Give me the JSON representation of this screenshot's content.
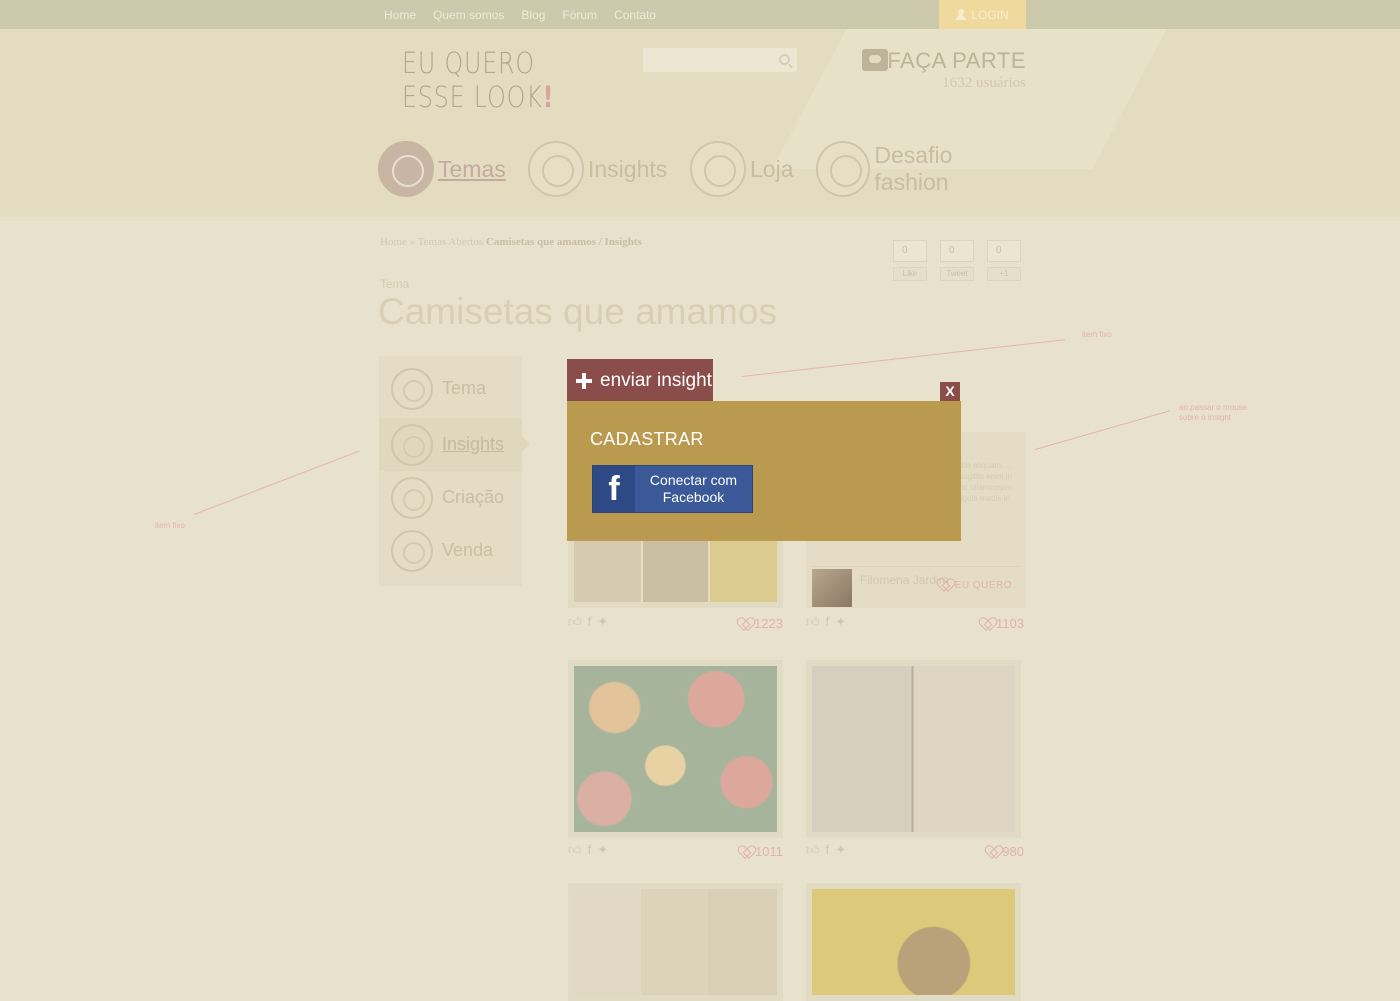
{
  "topnav": {
    "items": [
      "Home",
      "Quem somos",
      "Blog",
      "Fórum",
      "Contato"
    ],
    "login_label": "LOGIN"
  },
  "header": {
    "logo_line1": "EU QUERO",
    "logo_line2": "ESSE LOOK",
    "logo_mark": "!",
    "search_placeholder": "",
    "faca_parte": "FAÇA PARTE",
    "users_count": "1632 usuários"
  },
  "mainnav": [
    {
      "label": "Temas",
      "icon": "tshirt-icon"
    },
    {
      "label": "Insights",
      "icon": "lightbulb-icon"
    },
    {
      "label": "Loja",
      "icon": "shop-tag-icon"
    },
    {
      "label": "Desafio fashion",
      "icon": "puzzle-icon"
    }
  ],
  "breadcrumb": {
    "home": "Home",
    "sep": "»",
    "temas": "Temas Abertos",
    "current": "Camisetas que amamos / Insights"
  },
  "social": [
    {
      "count": "0",
      "label": "Like"
    },
    {
      "count": "0",
      "label": "Tweet"
    },
    {
      "count": "0",
      "label": "+1"
    }
  ],
  "page": {
    "label": "Tema",
    "title": "Camisetas que amamos"
  },
  "annotations": {
    "item_fixo_right": "item fixo",
    "item_fixo_left": "item fixo",
    "hover_line1": "ao passar o mouse",
    "hover_line2": "sobre o insight"
  },
  "sidebar": [
    {
      "label": "Tema",
      "icon": "tshirt-icon"
    },
    {
      "label": "Insights",
      "icon": "lightbulb-icon"
    },
    {
      "label": "Criação",
      "icon": "pencil-icon"
    },
    {
      "label": "Venda",
      "icon": "shop-tag-icon"
    }
  ],
  "cards": [
    {
      "likes": "1223"
    },
    {
      "likes": "1103"
    },
    {
      "likes": "1011"
    },
    {
      "likes": "980"
    }
  ],
  "textcard": {
    "text": "... nec dui in est ... sollicitudin gravida aliquam. ... sapien, vulputate ... ultrices metus ... sagittis enim in ... luctus. Curabitur ... semper nibh, ac ullamcorper ligula mattis in.",
    "author": "Filomena Jardim",
    "eu_quero": "EU QUERO"
  },
  "modal": {
    "tab_label": "enviar insight",
    "close_label": "X",
    "title": "CADASTRAR",
    "fb_button": "Conectar com Facebook",
    "fb_letter": "f"
  },
  "colors": {
    "modal_bg": "#b99a4e",
    "tab_bg": "#8a4d4a",
    "facebook": "#3b5998"
  }
}
